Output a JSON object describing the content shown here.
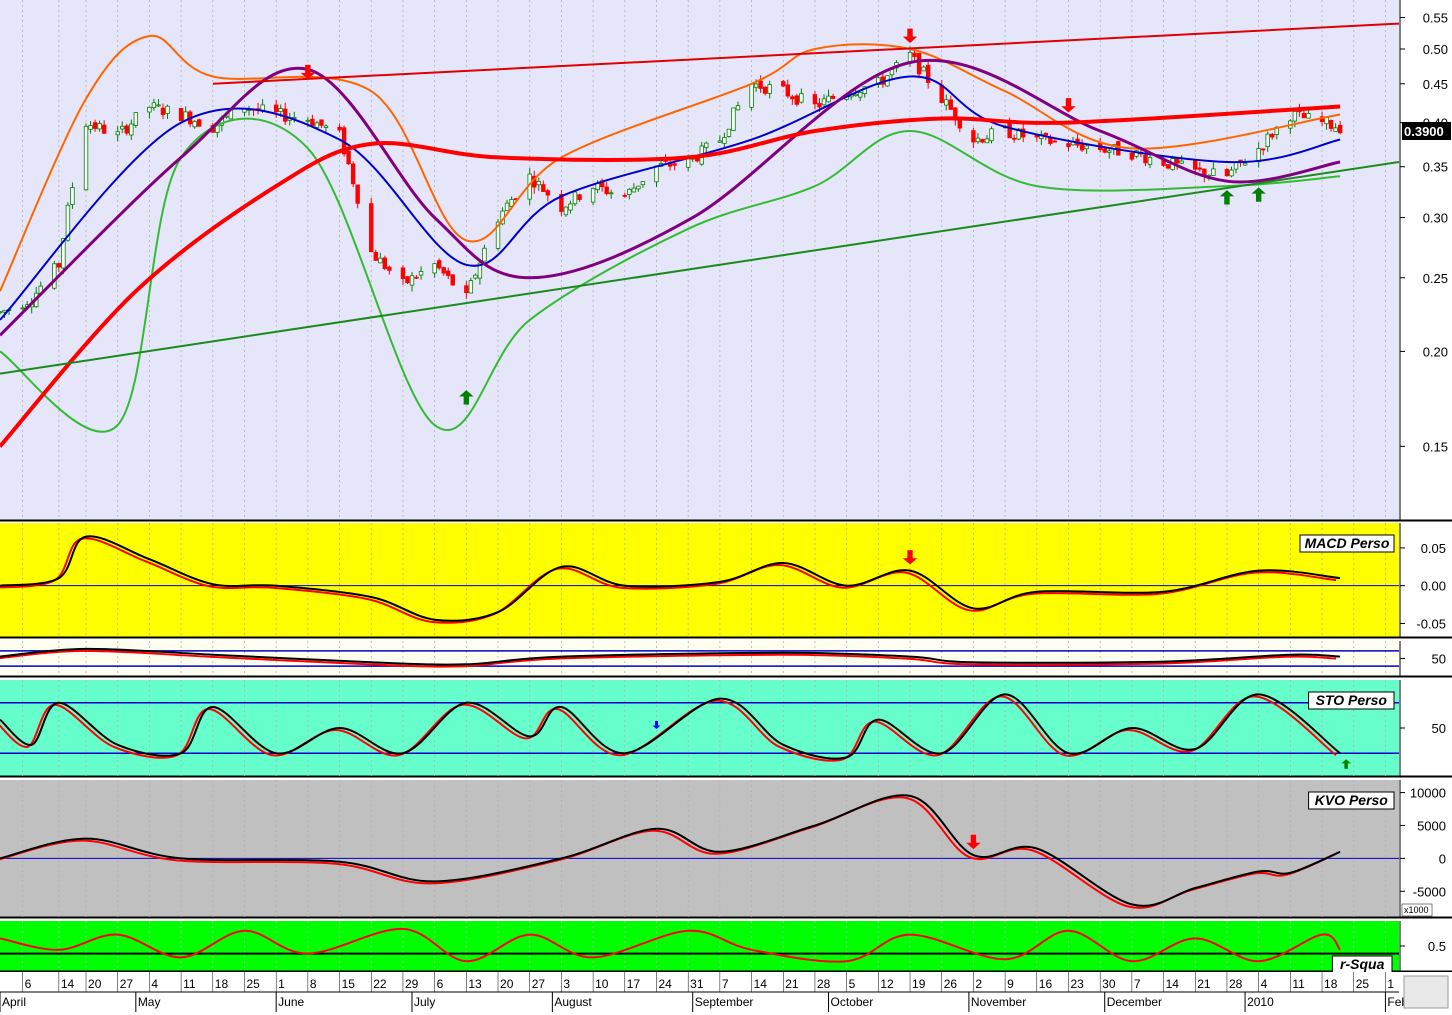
{
  "chart_data": [
    {
      "type": "candlestick",
      "name_hint": "price",
      "y_scale": "log",
      "ylim": [
        0.12,
        0.58
      ],
      "yticks": [
        "0.55",
        "0.50",
        "0.45",
        "0.40",
        "0.35",
        "0.30",
        "0.25",
        "0.20",
        "0.15"
      ],
      "last_price": "0.3900",
      "x_start": "2009-04-01",
      "x_end": "2010-02-04",
      "data_end": "2010-01-22",
      "grid": true,
      "price_path": [
        [
          "2009-04-01",
          0.225
        ],
        [
          "2009-04-08",
          0.235
        ],
        [
          "2009-04-14",
          0.26
        ],
        [
          "2009-04-20",
          0.4
        ],
        [
          "2009-04-27",
          0.385
        ],
        [
          "2009-05-04",
          0.42
        ],
        [
          "2009-05-11",
          0.41
        ],
        [
          "2009-05-18",
          0.395
        ],
        [
          "2009-05-25",
          0.42
        ],
        [
          "2009-06-01",
          0.41
        ],
        [
          "2009-06-08",
          0.405
        ],
        [
          "2009-06-15",
          0.385
        ],
        [
          "2009-06-22",
          0.27
        ],
        [
          "2009-06-29",
          0.245
        ],
        [
          "2009-07-06",
          0.26
        ],
        [
          "2009-07-13",
          0.235
        ],
        [
          "2009-07-20",
          0.3
        ],
        [
          "2009-07-27",
          0.34
        ],
        [
          "2009-08-03",
          0.31
        ],
        [
          "2009-08-10",
          0.33
        ],
        [
          "2009-08-17",
          0.32
        ],
        [
          "2009-08-24",
          0.35
        ],
        [
          "2009-08-31",
          0.355
        ],
        [
          "2009-09-07",
          0.38
        ],
        [
          "2009-09-14",
          0.45
        ],
        [
          "2009-09-21",
          0.44
        ],
        [
          "2009-09-28",
          0.42
        ],
        [
          "2009-10-05",
          0.44
        ],
        [
          "2009-10-12",
          0.45
        ],
        [
          "2009-10-19",
          0.49
        ],
        [
          "2009-10-26",
          0.43
        ],
        [
          "2009-11-02",
          0.38
        ],
        [
          "2009-11-09",
          0.39
        ],
        [
          "2009-11-16",
          0.38
        ],
        [
          "2009-11-23",
          0.375
        ],
        [
          "2009-11-30",
          0.37
        ],
        [
          "2009-12-07",
          0.365
        ],
        [
          "2009-12-14",
          0.355
        ],
        [
          "2009-12-21",
          0.345
        ],
        [
          "2009-12-28",
          0.34
        ],
        [
          "2010-01-04",
          0.37
        ],
        [
          "2010-01-11",
          0.41
        ],
        [
          "2010-01-18",
          0.4
        ],
        [
          "2010-01-22",
          0.395
        ]
      ],
      "ma_red_path": [
        [
          "2009-04-01",
          0.15
        ],
        [
          "2009-05-01",
          0.24
        ],
        [
          "2009-06-01",
          0.33
        ],
        [
          "2009-06-22",
          0.375
        ],
        [
          "2009-07-20",
          0.36
        ],
        [
          "2009-08-31",
          0.36
        ],
        [
          "2009-09-28",
          0.39
        ],
        [
          "2009-10-26",
          0.405
        ],
        [
          "2009-11-23",
          0.4
        ],
        [
          "2010-01-22",
          0.42
        ]
      ],
      "ma_purple_path": [
        [
          "2009-04-01",
          0.21
        ],
        [
          "2009-05-11",
          0.36
        ],
        [
          "2009-06-08",
          0.47
        ],
        [
          "2009-07-06",
          0.3
        ],
        [
          "2009-07-27",
          0.25
        ],
        [
          "2009-09-01",
          0.3
        ],
        [
          "2009-10-19",
          0.48
        ],
        [
          "2009-11-30",
          0.39
        ],
        [
          "2009-12-28",
          0.335
        ],
        [
          "2010-01-22",
          0.355
        ]
      ],
      "ma_blue_path": [
        [
          "2009-04-01",
          0.22
        ],
        [
          "2009-05-11",
          0.4
        ],
        [
          "2009-06-15",
          0.38
        ],
        [
          "2009-07-13",
          0.26
        ],
        [
          "2009-08-03",
          0.32
        ],
        [
          "2009-09-14",
          0.38
        ],
        [
          "2009-10-19",
          0.46
        ],
        [
          "2009-11-09",
          0.395
        ],
        [
          "2009-12-28",
          0.355
        ],
        [
          "2010-01-22",
          0.38
        ]
      ],
      "band_upper_path": [
        [
          "2009-04-01",
          0.24
        ],
        [
          "2009-04-20",
          0.43
        ],
        [
          "2009-05-04",
          0.52
        ],
        [
          "2009-05-18",
          0.46
        ],
        [
          "2009-06-22",
          0.44
        ],
        [
          "2009-07-13",
          0.28
        ],
        [
          "2009-08-03",
          0.36
        ],
        [
          "2009-09-14",
          0.45
        ],
        [
          "2009-09-28",
          0.5
        ],
        [
          "2009-10-19",
          0.5
        ],
        [
          "2009-11-09",
          0.44
        ],
        [
          "2009-12-07",
          0.37
        ],
        [
          "2010-01-22",
          0.41
        ]
      ],
      "band_lower_path": [
        [
          "2009-04-01",
          0.2
        ],
        [
          "2009-04-27",
          0.16
        ],
        [
          "2009-05-11",
          0.36
        ],
        [
          "2009-06-08",
          0.37
        ],
        [
          "2009-07-06",
          0.16
        ],
        [
          "2009-07-27",
          0.22
        ],
        [
          "2009-08-31",
          0.29
        ],
        [
          "2009-09-28",
          0.33
        ],
        [
          "2009-10-19",
          0.39
        ],
        [
          "2009-11-16",
          0.33
        ],
        [
          "2009-12-28",
          0.33
        ],
        [
          "2010-01-22",
          0.34
        ]
      ],
      "trendline_red": [
        [
          "2009-05-18",
          0.45
        ],
        [
          "2010-02-04",
          0.54
        ]
      ],
      "trendline_green": [
        [
          "2009-04-01",
          0.187
        ],
        [
          "2010-02-04",
          0.355
        ]
      ],
      "sell_arrows": [
        "2009-06-08",
        "2009-10-19",
        "2009-11-23"
      ],
      "buy_arrows": [
        "2009-07-13",
        "2009-12-28",
        "2010-01-04"
      ],
      "colors": {
        "up": "#008000",
        "down": "#ff0000",
        "bg": "#e6e6fa",
        "ma_long": "#ff0000",
        "ma_mid": "#800080",
        "ma_short": "#0000cc",
        "band_upper": "#ff6600",
        "band_lower": "#33bb33",
        "midband": "#2e8b8b"
      }
    },
    {
      "type": "line",
      "name_hint": "macd",
      "label": "MACD Perso",
      "ylim": [
        -0.06,
        0.075
      ],
      "yticks": [
        "0.05",
        "0.00",
        "-0.05"
      ],
      "points": [
        [
          "2009-04-01",
          0.0
        ],
        [
          "2009-04-14",
          0.01
        ],
        [
          "2009-04-20",
          0.065
        ],
        [
          "2009-05-04",
          0.035
        ],
        [
          "2009-05-18",
          0.002
        ],
        [
          "2009-06-01",
          0.0
        ],
        [
          "2009-06-22",
          -0.015
        ],
        [
          "2009-07-06",
          -0.045
        ],
        [
          "2009-07-20",
          -0.035
        ],
        [
          "2009-08-03",
          0.025
        ],
        [
          "2009-08-17",
          0.0
        ],
        [
          "2009-09-07",
          0.005
        ],
        [
          "2009-09-21",
          0.03
        ],
        [
          "2009-10-05",
          0.0
        ],
        [
          "2009-10-19",
          0.02
        ],
        [
          "2009-11-02",
          -0.03
        ],
        [
          "2009-11-16",
          -0.008
        ],
        [
          "2009-12-14",
          -0.008
        ],
        [
          "2010-01-04",
          0.02
        ],
        [
          "2010-01-22",
          0.01
        ]
      ],
      "baseline": 0,
      "sell_arrows": [
        "2009-10-19"
      ],
      "colors": {
        "bg": "#ffff00",
        "line": "#000000",
        "signal": "#ff0000"
      }
    },
    {
      "type": "line",
      "name_hint": "rsi",
      "ylim": [
        20,
        80
      ],
      "yticks": [
        "50"
      ],
      "levels": [
        30,
        70
      ],
      "points": [
        [
          "2009-04-01",
          55
        ],
        [
          "2009-04-20",
          75
        ],
        [
          "2009-05-18",
          60
        ],
        [
          "2009-06-22",
          40
        ],
        [
          "2009-07-13",
          35
        ],
        [
          "2009-08-03",
          55
        ],
        [
          "2009-09-21",
          65
        ],
        [
          "2009-10-19",
          55
        ],
        [
          "2009-11-02",
          40
        ],
        [
          "2009-12-14",
          42
        ],
        [
          "2010-01-11",
          60
        ],
        [
          "2010-01-22",
          55
        ]
      ],
      "colors": {
        "bg": "#fffff0",
        "line": "#000000",
        "signal": "#ff0000"
      }
    },
    {
      "type": "line",
      "name_hint": "stochastic",
      "label": "STO Perso",
      "ylim": [
        0,
        100
      ],
      "yticks": [
        "50"
      ],
      "levels": [
        20,
        80
      ],
      "points": [
        [
          "2009-04-01",
          60
        ],
        [
          "2009-04-08",
          30
        ],
        [
          "2009-04-14",
          80
        ],
        [
          "2009-04-27",
          30
        ],
        [
          "2009-05-11",
          20
        ],
        [
          "2009-05-18",
          75
        ],
        [
          "2009-06-01",
          20
        ],
        [
          "2009-06-15",
          50
        ],
        [
          "2009-06-29",
          20
        ],
        [
          "2009-07-13",
          80
        ],
        [
          "2009-07-27",
          40
        ],
        [
          "2009-08-03",
          75
        ],
        [
          "2009-08-17",
          20
        ],
        [
          "2009-09-07",
          85
        ],
        [
          "2009-09-21",
          30
        ],
        [
          "2009-10-05",
          15
        ],
        [
          "2009-10-12",
          60
        ],
        [
          "2009-10-26",
          20
        ],
        [
          "2009-11-09",
          90
        ],
        [
          "2009-11-23",
          20
        ],
        [
          "2009-12-07",
          50
        ],
        [
          "2009-12-21",
          25
        ],
        [
          "2010-01-04",
          90
        ],
        [
          "2010-01-22",
          20
        ]
      ],
      "buy_arrows": [
        "2010-01-22"
      ],
      "sell_arrows": [
        "2009-08-24"
      ],
      "colors": {
        "bg": "#66ffcc",
        "line": "#000000",
        "signal": "#ff0000"
      }
    },
    {
      "type": "line",
      "name_hint": "kvo",
      "label": "KVO Perso",
      "ylim": [
        -8000,
        11000
      ],
      "yticks": [
        "10000",
        "5000",
        "0",
        "-5000"
      ],
      "unit": "x1000",
      "points": [
        [
          "2009-04-01",
          0
        ],
        [
          "2009-04-20",
          3000
        ],
        [
          "2009-05-11",
          0
        ],
        [
          "2009-06-15",
          -500
        ],
        [
          "2009-07-06",
          -3500
        ],
        [
          "2009-08-03",
          0
        ],
        [
          "2009-08-24",
          4500
        ],
        [
          "2009-09-07",
          1000
        ],
        [
          "2009-09-28",
          5000
        ],
        [
          "2009-10-19",
          9500
        ],
        [
          "2009-11-02",
          500
        ],
        [
          "2009-11-16",
          1500
        ],
        [
          "2009-12-07",
          -7000
        ],
        [
          "2009-12-21",
          -4500
        ],
        [
          "2010-01-04",
          -2000
        ],
        [
          "2010-01-11",
          -2200
        ],
        [
          "2010-01-22",
          1000
        ]
      ],
      "baseline": 0,
      "sell_arrows": [
        "2009-11-02"
      ],
      "colors": {
        "bg": "#c0c0c0",
        "line": "#000000",
        "signal": "#ff0000"
      }
    },
    {
      "type": "line",
      "name_hint": "r_squared",
      "label": "r-Squa",
      "ylim": [
        0,
        1
      ],
      "yticks": [
        "0.5"
      ],
      "level": 0.3,
      "points": [
        [
          "2009-04-01",
          0.7
        ],
        [
          "2009-04-14",
          0.4
        ],
        [
          "2009-04-27",
          0.8
        ],
        [
          "2009-05-11",
          0.2
        ],
        [
          "2009-05-25",
          0.9
        ],
        [
          "2009-06-08",
          0.3
        ],
        [
          "2009-06-29",
          0.95
        ],
        [
          "2009-07-13",
          0.1
        ],
        [
          "2009-07-27",
          0.8
        ],
        [
          "2009-08-10",
          0.2
        ],
        [
          "2009-08-31",
          0.9
        ],
        [
          "2009-09-14",
          0.4
        ],
        [
          "2009-10-05",
          0.1
        ],
        [
          "2009-10-19",
          0.8
        ],
        [
          "2009-11-09",
          0.15
        ],
        [
          "2009-11-23",
          0.9
        ],
        [
          "2009-12-07",
          0.1
        ],
        [
          "2009-12-21",
          0.7
        ],
        [
          "2010-01-04",
          0.1
        ],
        [
          "2010-01-18",
          0.8
        ],
        [
          "2010-01-22",
          0.4
        ]
      ],
      "colors": {
        "bg": "#00ff00",
        "line": "#ff0000",
        "level_line": "#000000"
      }
    }
  ],
  "x_axis": {
    "month_labels": [
      [
        "2009-04-01",
        "April"
      ],
      [
        "2009-05-01",
        "May"
      ],
      [
        "2009-06-01",
        "June"
      ],
      [
        "2009-07-01",
        "July"
      ],
      [
        "2009-08-01",
        "August"
      ],
      [
        "2009-09-01",
        "September"
      ],
      [
        "2009-10-01",
        "October"
      ],
      [
        "2009-11-01",
        "November"
      ],
      [
        "2009-12-01",
        "December"
      ],
      [
        "2010-01-01",
        "2010"
      ],
      [
        "2010-02-01",
        "Febru"
      ]
    ],
    "day_labels": [
      [
        "2009-04-06",
        "6"
      ],
      [
        "2009-04-14",
        "14"
      ],
      [
        "2009-04-20",
        "20"
      ],
      [
        "2009-04-27",
        "27"
      ],
      [
        "2009-05-04",
        "4"
      ],
      [
        "2009-05-11",
        "11"
      ],
      [
        "2009-05-18",
        "18"
      ],
      [
        "2009-05-25",
        "25"
      ],
      [
        "2009-06-01",
        "1"
      ],
      [
        "2009-06-08",
        "8"
      ],
      [
        "2009-06-15",
        "15"
      ],
      [
        "2009-06-22",
        "22"
      ],
      [
        "2009-06-29",
        "29"
      ],
      [
        "2009-07-06",
        "6"
      ],
      [
        "2009-07-13",
        "13"
      ],
      [
        "2009-07-20",
        "20"
      ],
      [
        "2009-07-27",
        "27"
      ],
      [
        "2009-08-03",
        "3"
      ],
      [
        "2009-08-10",
        "10"
      ],
      [
        "2009-08-17",
        "17"
      ],
      [
        "2009-08-24",
        "24"
      ],
      [
        "2009-08-31",
        "31"
      ],
      [
        "2009-09-07",
        "7"
      ],
      [
        "2009-09-14",
        "14"
      ],
      [
        "2009-09-21",
        "21"
      ],
      [
        "2009-09-28",
        "28"
      ],
      [
        "2009-10-05",
        "5"
      ],
      [
        "2009-10-12",
        "12"
      ],
      [
        "2009-10-19",
        "19"
      ],
      [
        "2009-10-26",
        "26"
      ],
      [
        "2009-11-02",
        "2"
      ],
      [
        "2009-11-09",
        "9"
      ],
      [
        "2009-11-16",
        "16"
      ],
      [
        "2009-11-23",
        "23"
      ],
      [
        "2009-11-30",
        "30"
      ],
      [
        "2009-12-07",
        "7"
      ],
      [
        "2009-12-14",
        "14"
      ],
      [
        "2009-12-21",
        "21"
      ],
      [
        "2009-12-28",
        "28"
      ],
      [
        "2010-01-04",
        "4"
      ],
      [
        "2010-01-11",
        "11"
      ],
      [
        "2010-01-18",
        "18"
      ],
      [
        "2010-01-25",
        "25"
      ],
      [
        "2010-02-01",
        "1"
      ]
    ]
  }
}
